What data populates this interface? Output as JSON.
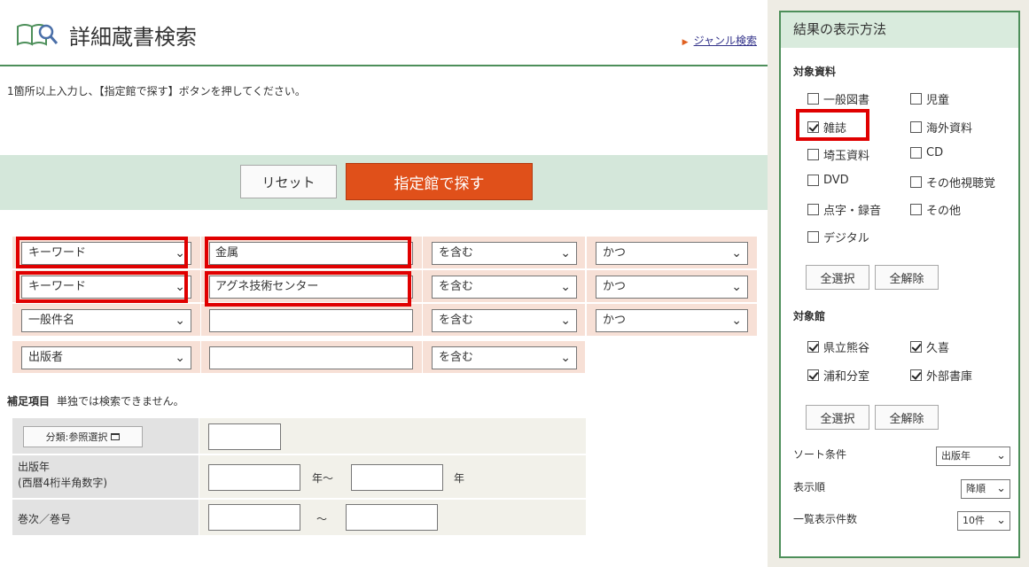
{
  "header": {
    "title": "詳細蔵書検索",
    "genre_link": "ジャンル検索"
  },
  "instructions": "1箇所以上入力し、【指定館で探す】ボタンを押してください。",
  "buttons": {
    "reset": "リセット",
    "search": "指定館で探す"
  },
  "criteria": [
    {
      "field": "キーワード",
      "value": "金属",
      "match": "を含む",
      "conj": "かつ"
    },
    {
      "field": "キーワード",
      "value": "アグネ技術センター",
      "match": "を含む",
      "conj": "かつ"
    },
    {
      "field": "一般件名",
      "value": "",
      "match": "を含む",
      "conj": "かつ"
    },
    {
      "field": "出版者",
      "value": "",
      "match": "を含む"
    }
  ],
  "supplement": {
    "heading": "補足項目",
    "note": "単独では検索できません。",
    "bunrui_button": "分類:参照選択",
    "pubyear_label_line1": "出版年",
    "pubyear_label_line2": "(西暦4桁半角数字)",
    "year_from_suffix": "年～",
    "year_to_suffix": "年",
    "volume_label": "巻次／巻号",
    "volume_sep": "～"
  },
  "side": {
    "header": "結果の表示方法",
    "materials_title": "対象資料",
    "materials": [
      {
        "label": "一般図書",
        "checked": false
      },
      {
        "label": "児童",
        "checked": false
      },
      {
        "label": "雑誌",
        "checked": true
      },
      {
        "label": "海外資料",
        "checked": false
      },
      {
        "label": "埼玉資料",
        "checked": false
      },
      {
        "label": "CD",
        "checked": false
      },
      {
        "label": "DVD",
        "checked": false
      },
      {
        "label": "その他視聴覚",
        "checked": false
      },
      {
        "label": "点字・録音",
        "checked": false
      },
      {
        "label": "その他",
        "checked": false
      },
      {
        "label": "デジタル",
        "checked": false
      }
    ],
    "select_all": "全選択",
    "deselect_all": "全解除",
    "libraries_title": "対象館",
    "libraries": [
      {
        "label": "県立熊谷",
        "checked": true
      },
      {
        "label": "久喜",
        "checked": true
      },
      {
        "label": "浦和分室",
        "checked": true
      },
      {
        "label": "外部書庫",
        "checked": true
      }
    ],
    "sort_label": "ソート条件",
    "sort_value": "出版年",
    "order_label": "表示順",
    "order_value": "降順",
    "count_label": "一覧表示件数",
    "count_value": "10件"
  },
  "colors": {
    "accent_green": "#4d8f5a",
    "search_button": "#e0501a",
    "highlight": "#e00000"
  }
}
